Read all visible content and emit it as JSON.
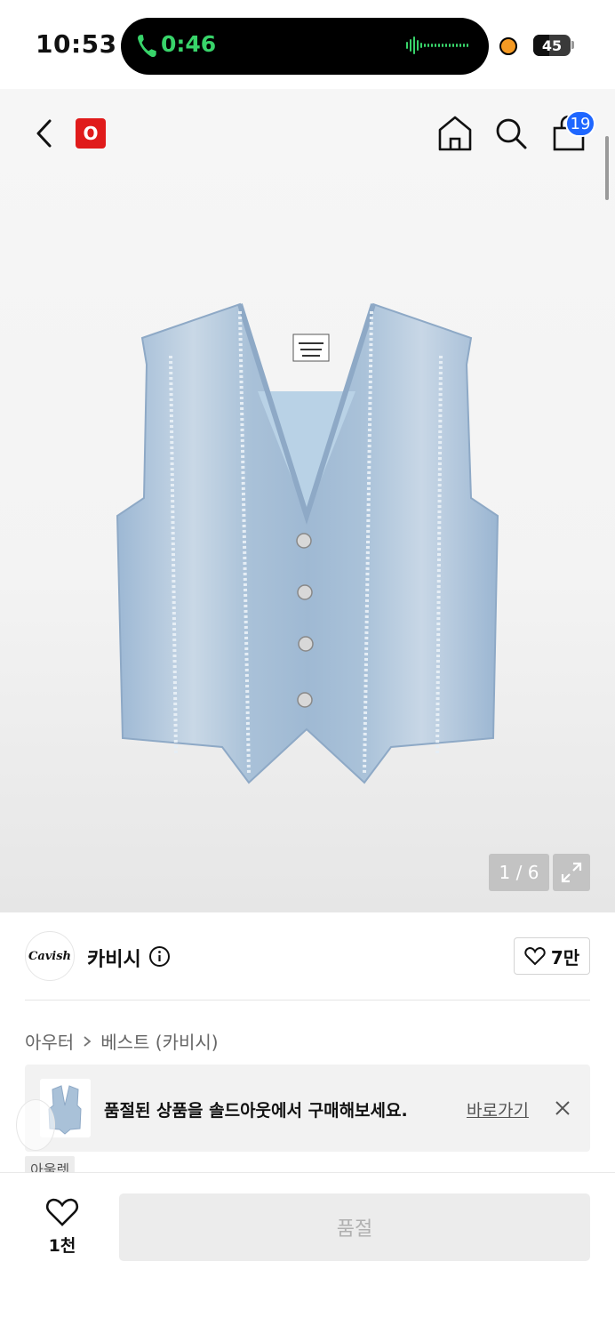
{
  "status_bar": {
    "time": "10:53",
    "call_duration": "0:46",
    "battery": "45"
  },
  "nav": {
    "brand_badge": "O",
    "cart_count": "19",
    "icons": [
      "back-arrow-icon",
      "home-icon",
      "search-icon",
      "shopping-bag-icon"
    ]
  },
  "gallery": {
    "counter": "1 / 6"
  },
  "brand": {
    "logo_text": "Cavish",
    "name": "카비시",
    "likes": "7만"
  },
  "breadcrumb": {
    "category": "아우터",
    "subcategory": "베스트 (카비시)"
  },
  "banner": {
    "message": "품절된 상품을 솔드아웃에서 구매해보세요.",
    "link": "바로가기"
  },
  "outlet_tag": "아울렛",
  "bottom": {
    "likes": "1천",
    "action": "품절"
  },
  "colors": {
    "accent_blue": "#1f67ff",
    "badge_red": "#e01b1b",
    "call_green": "#38d46a"
  }
}
